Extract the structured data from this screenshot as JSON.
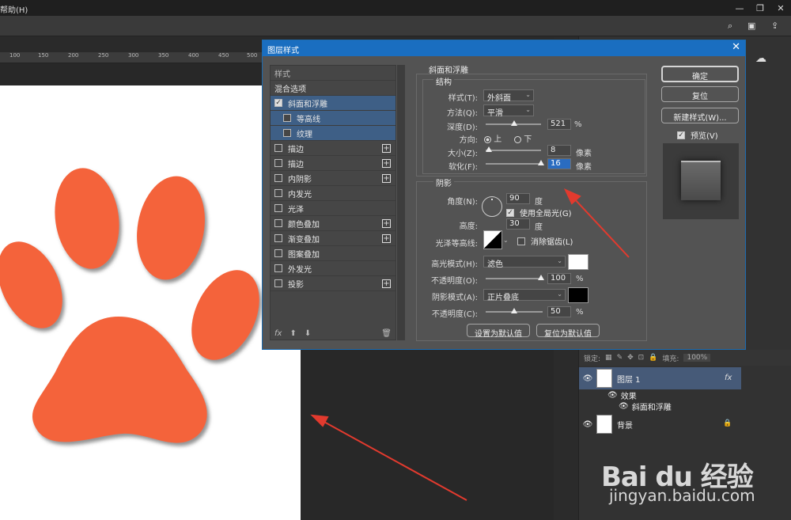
{
  "menubar": {
    "help_menu": "帮助(H)"
  },
  "window_controls": {
    "minimize": "—",
    "restore": "❐",
    "close": "✕"
  },
  "ruler": {
    "ticks": [
      "100",
      "150",
      "200",
      "250",
      "300",
      "350",
      "400",
      "450",
      "500"
    ]
  },
  "dialog": {
    "title": "图层样式",
    "close": "✕",
    "style_list": {
      "header": "样式",
      "blend_options": "混合选项",
      "items": [
        {
          "label": "斜面和浮雕",
          "checked": true
        },
        {
          "label": "等高线",
          "checked": false
        },
        {
          "label": "纹理",
          "checked": false
        },
        {
          "label": "描边",
          "checked": false,
          "plus": true
        },
        {
          "label": "描边",
          "checked": false,
          "plus": true
        },
        {
          "label": "内阴影",
          "checked": false,
          "plus": true
        },
        {
          "label": "内发光",
          "checked": false
        },
        {
          "label": "光泽",
          "checked": false
        },
        {
          "label": "颜色叠加",
          "checked": false,
          "plus": true
        },
        {
          "label": "渐变叠加",
          "checked": false,
          "plus": true
        },
        {
          "label": "图案叠加",
          "checked": false
        },
        {
          "label": "外发光",
          "checked": false
        },
        {
          "label": "投影",
          "checked": false,
          "plus": true
        }
      ],
      "footer_fx": "fx",
      "footer_up": "⬆",
      "footer_down": "⬇",
      "footer_trash": "🗑"
    },
    "bevel": {
      "section_title": "斜面和浮雕",
      "structure_title": "结构",
      "style_label": "样式(T):",
      "style_value": "外斜面",
      "technique_label": "方法(Q):",
      "technique_value": "平滑",
      "depth_label": "深度(D):",
      "depth_value": "521",
      "depth_fraction": 0.5,
      "depth_unit": "%",
      "direction_label": "方向:",
      "direction_up": "上",
      "direction_down": "下",
      "size_label": "大小(Z):",
      "size_value": "8",
      "size_fraction": 0.05,
      "size_unit": "像素",
      "soften_label": "软化(F):",
      "soften_value": "16",
      "soften_fraction": 0.98,
      "soften_unit": "像素"
    },
    "shading": {
      "title": "阴影",
      "angle_label": "角度(N):",
      "angle_value": "90",
      "angle_unit": "度",
      "global_light_label": "使用全局光(G)",
      "altitude_label": "高度:",
      "altitude_value": "30",
      "altitude_unit": "度",
      "gloss_label": "光泽等高线:",
      "antialias_label": "消除锯齿(L)",
      "highlight_mode_label": "高光模式(H):",
      "highlight_mode_value": "滤色",
      "highlight_color": "#ffffff",
      "highlight_opacity_label": "不透明度(O):",
      "highlight_opacity_value": "100",
      "highlight_opacity_fraction": 1.0,
      "shadow_mode_label": "阴影模式(A):",
      "shadow_mode_value": "正片叠底",
      "shadow_color": "#000000",
      "shadow_opacity_label": "不透明度(C):",
      "shadow_opacity_value": "50",
      "shadow_opacity_fraction": 0.5,
      "percent": "%"
    },
    "buttons": {
      "ok": "确定",
      "reset": "复位",
      "new_style": "新建样式(W)...",
      "preview": "预览(V)",
      "make_default": "设置为默认值",
      "reset_default": "复位为默认值"
    }
  },
  "layers": {
    "lock_label": "锁定:",
    "fill_label": "填充:",
    "fill_value": "100%",
    "layer1": "图层 1",
    "fx": "fx",
    "effects": "效果",
    "bevel": "斜面和浮雕",
    "background": "背景"
  },
  "watermark": {
    "brand": "Bai du 经验",
    "url": "jingyan.baidu.com"
  },
  "colors": {
    "paw": "#f4643a",
    "arrow": "#e23a2e",
    "accent": "#1a6ec0"
  }
}
